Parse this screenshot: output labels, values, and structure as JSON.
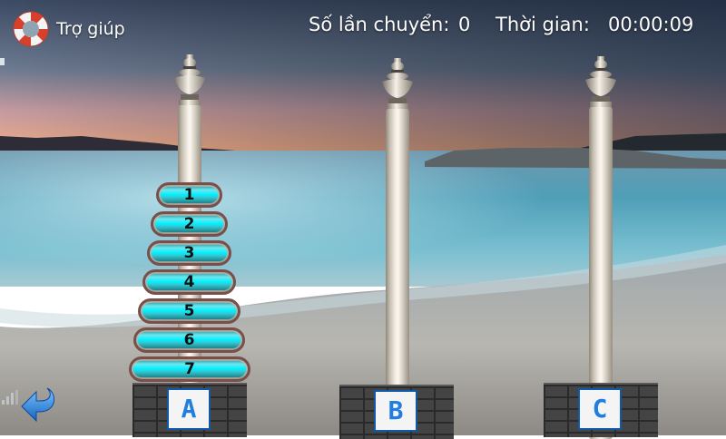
{
  "help": {
    "label": "Trợ giúp",
    "icon": "lifebuoy-icon"
  },
  "stats": {
    "moves_label": "Số lần chuyển:",
    "moves_value": "0",
    "time_label": "Thời gian:",
    "time_value": "00:00:09"
  },
  "pegs": [
    {
      "label": "A",
      "disks": [
        "1",
        "2",
        "3",
        "4",
        "5",
        "6",
        "7"
      ]
    },
    {
      "label": "B",
      "disks": []
    },
    {
      "label": "C",
      "disks": []
    }
  ],
  "colors": {
    "disk_accent": "#00f0ff",
    "peg_label": "#1f7ee0",
    "label_border": "#0e5aa8"
  },
  "icons": {
    "back": "back-arrow-icon",
    "signal": "signal-icon"
  }
}
